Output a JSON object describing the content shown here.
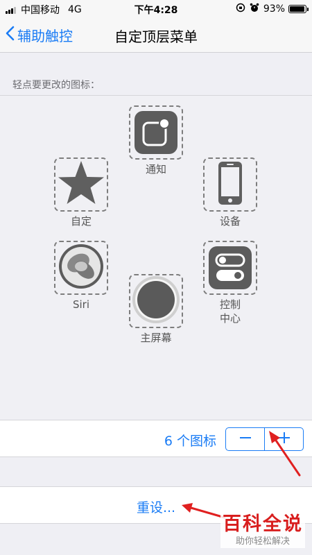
{
  "status": {
    "carrier": "中国移动",
    "network": "4G",
    "time": "下午4:28",
    "battery": "93%",
    "icons": [
      "signal-icon",
      "rotation-lock-icon",
      "alarm-icon",
      "battery-icon"
    ]
  },
  "nav": {
    "back_label": "辅助触控",
    "title": "自定顶层菜单"
  },
  "section": {
    "header": "轻点要更改的图标："
  },
  "icons": [
    {
      "label": "通知",
      "icon": "notification-icon"
    },
    {
      "label": "自定",
      "icon": "star-icon"
    },
    {
      "label": "设备",
      "icon": "device-icon"
    },
    {
      "label": "Siri",
      "icon": "siri-icon"
    },
    {
      "label": "控制\n中心",
      "icon": "control-center-icon"
    },
    {
      "label": "主屏幕",
      "icon": "home-button-icon"
    }
  ],
  "stepper": {
    "count_label": "6 个图标",
    "minus_icon": "minus-icon",
    "plus_icon": "plus-icon"
  },
  "reset": {
    "label": "重设..."
  },
  "watermark": {
    "title": "百科全说",
    "subtitle": "助你轻松解决"
  },
  "colors": {
    "accent": "#1a7cf5",
    "arrow": "#e02020",
    "background": "#efeff4"
  }
}
